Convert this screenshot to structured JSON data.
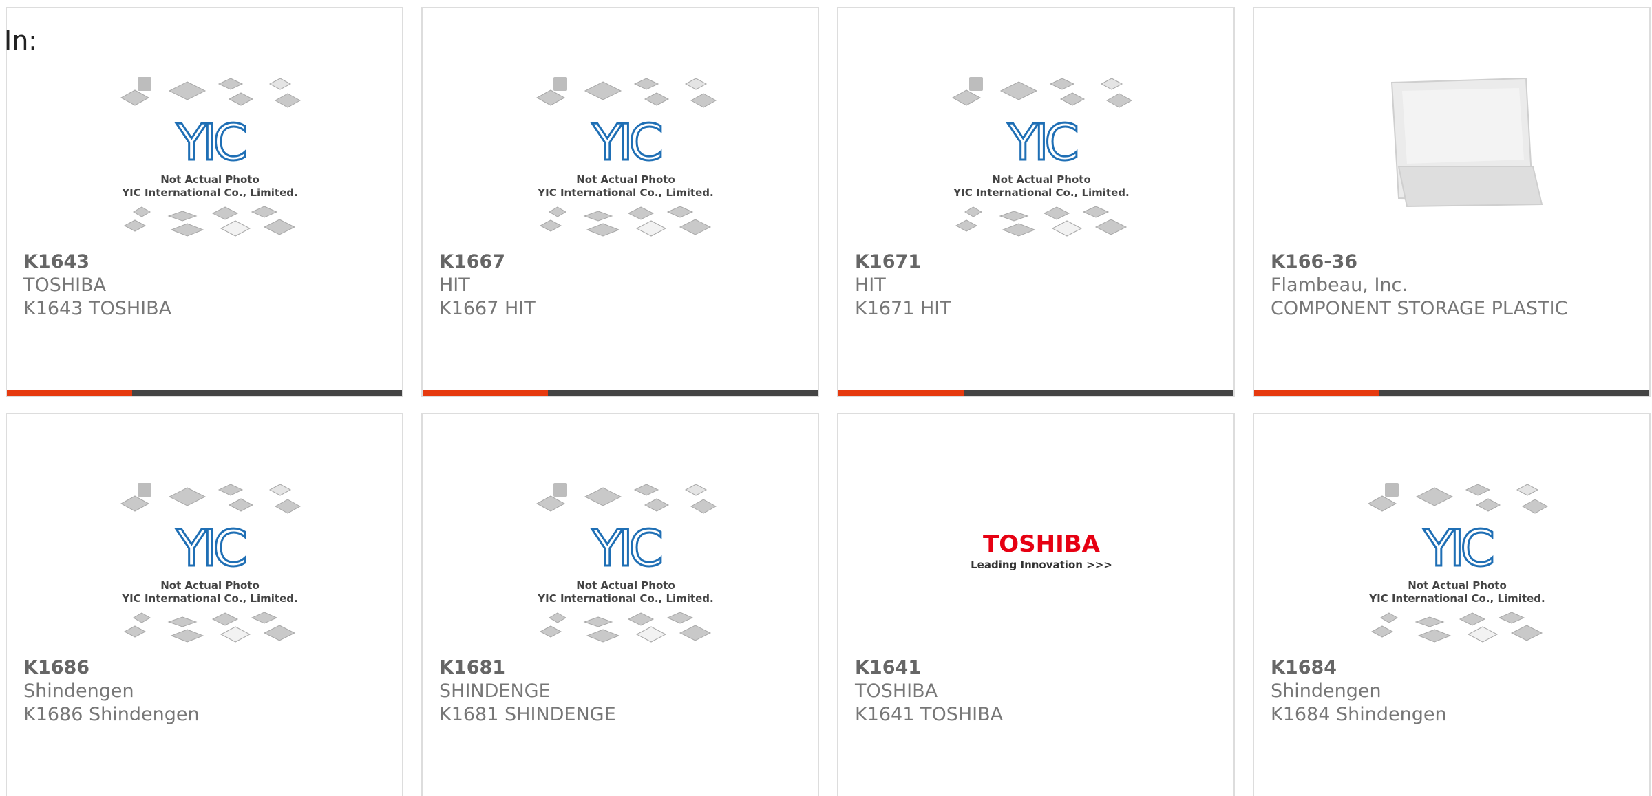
{
  "filter_label": "In:",
  "colors": {
    "accent": "#e63a0f",
    "bar": "#444444",
    "text": "#777777"
  },
  "placeholder_image": {
    "line1": "Not Actual Photo",
    "line2": "YIC International Co., Limited.",
    "logo": "YIC"
  },
  "toshiba_logo": {
    "name": "TOSHIBA",
    "tagline": "Leading Innovation >>>"
  },
  "products": [
    {
      "part": "K1643",
      "manufacturer": "TOSHIBA",
      "description": "K1643 TOSHIBA",
      "image": "yic-placeholder"
    },
    {
      "part": "K1667",
      "manufacturer": "HIT",
      "description": "K1667 HIT",
      "image": "yic-placeholder"
    },
    {
      "part": "K1671",
      "manufacturer": "HIT",
      "description": "K1671 HIT",
      "image": "yic-placeholder"
    },
    {
      "part": "K166-36",
      "manufacturer": "Flambeau, Inc.",
      "description": "COMPONENT STORAGE PLASTIC",
      "image": "storage-box-photo"
    },
    {
      "part": "K1686",
      "manufacturer": "Shindengen",
      "description": "K1686 Shindengen",
      "image": "yic-placeholder"
    },
    {
      "part": "K1681",
      "manufacturer": "SHINDENGE",
      "description": "K1681 SHINDENGE",
      "image": "yic-placeholder"
    },
    {
      "part": "K1641",
      "manufacturer": "TOSHIBA",
      "description": "K1641 TOSHIBA",
      "image": "toshiba-logo"
    },
    {
      "part": "K1684",
      "manufacturer": "Shindengen",
      "description": "K1684 Shindengen",
      "image": "yic-placeholder"
    }
  ]
}
